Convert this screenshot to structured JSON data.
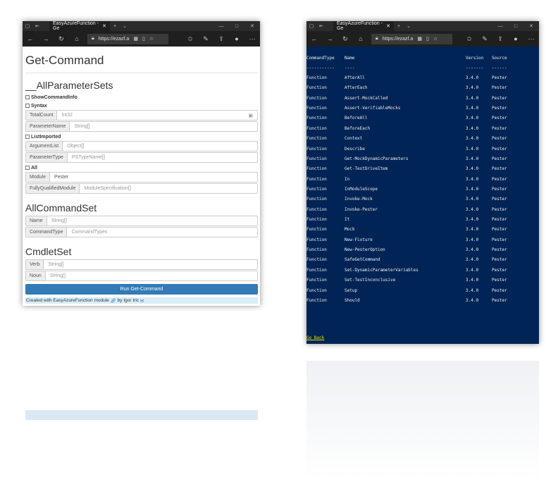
{
  "browser": {
    "tab_title": "EasyAzureFunction - Ge",
    "url": "https://ezazf.a"
  },
  "form": {
    "title": "Get-Command",
    "sections": [
      {
        "title": "__AllParameterSets"
      },
      {
        "title": "AllCommandSet"
      },
      {
        "title": "CmdletSet"
      }
    ],
    "checkboxes": [
      "ShowCommandInfo",
      "Syntax",
      "ListImported",
      "All"
    ],
    "fields": {
      "TotalCount": {
        "label": "TotalCount",
        "placeholder": "Int32"
      },
      "ParameterName": {
        "label": "ParameterName",
        "placeholder": "String[]"
      },
      "ArgumentList": {
        "label": "ArgumentList",
        "placeholder": "Object[]"
      },
      "ParameterType": {
        "label": "ParameterType",
        "placeholder": "PSTypeName[]"
      },
      "Module": {
        "label": "Module",
        "value": "Pester"
      },
      "FullyQualifiedModule": {
        "label": "FullyQualifiedModule",
        "placeholder": "ModuleSpecification[]"
      },
      "Name": {
        "label": "Name",
        "placeholder": "String[]"
      },
      "CommandType": {
        "label": "CommandType",
        "placeholder": "CommandTypes"
      },
      "Verb": {
        "label": "Verb",
        "placeholder": "String[]"
      },
      "Noun": {
        "label": "Noun",
        "placeholder": "String[]"
      }
    },
    "run_button": "Run Get-Command",
    "footer": {
      "text1": "Created with EasyAzureFunction module",
      "text2": "by Igor Iric"
    }
  },
  "output": {
    "headers": [
      "CommandType",
      "Name",
      "Version",
      "Source"
    ],
    "dashes": [
      "-----------",
      "----",
      "-------",
      "------"
    ],
    "rows": [
      [
        "Function",
        "AfterAll",
        "3.4.0",
        "Pester"
      ],
      [
        "Function",
        "AfterEach",
        "3.4.0",
        "Pester"
      ],
      [
        "Function",
        "Assert-MockCalled",
        "3.4.0",
        "Pester"
      ],
      [
        "Function",
        "Assert-VerifiableMocks",
        "3.4.0",
        "Pester"
      ],
      [
        "Function",
        "BeforeAll",
        "3.4.0",
        "Pester"
      ],
      [
        "Function",
        "BeforeEach",
        "3.4.0",
        "Pester"
      ],
      [
        "Function",
        "Context",
        "3.4.0",
        "Pester"
      ],
      [
        "Function",
        "Describe",
        "3.4.0",
        "Pester"
      ],
      [
        "Function",
        "Get-MockDynamicParameters",
        "3.4.0",
        "Pester"
      ],
      [
        "Function",
        "Get-TestDriveItem",
        "3.4.0",
        "Pester"
      ],
      [
        "Function",
        "In",
        "3.4.0",
        "Pester"
      ],
      [
        "Function",
        "InModuleScope",
        "3.4.0",
        "Pester"
      ],
      [
        "Function",
        "Invoke-Mock",
        "3.4.0",
        "Pester"
      ],
      [
        "Function",
        "Invoke-Pester",
        "3.4.0",
        "Pester"
      ],
      [
        "Function",
        "It",
        "3.4.0",
        "Pester"
      ],
      [
        "Function",
        "Mock",
        "3.4.0",
        "Pester"
      ],
      [
        "Function",
        "New-Fixture",
        "3.4.0",
        "Pester"
      ],
      [
        "Function",
        "New-PesterOption",
        "3.4.0",
        "Pester"
      ],
      [
        "Function",
        "SafeGetCommand",
        "3.4.0",
        "Pester"
      ],
      [
        "Function",
        "Set-DynamicParameterVariables",
        "3.4.0",
        "Pester"
      ],
      [
        "Function",
        "Set-TestInconclusive",
        "3.4.0",
        "Pester"
      ],
      [
        "Function",
        "Setup",
        "3.4.0",
        "Pester"
      ],
      [
        "Function",
        "Should",
        "3.4.0",
        "Pester"
      ]
    ],
    "go_back": "Go Back"
  }
}
